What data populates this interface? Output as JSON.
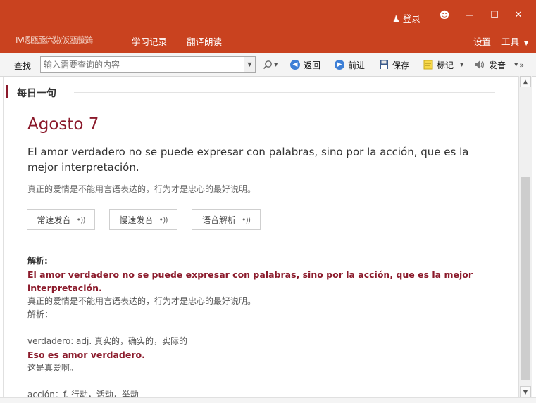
{
  "titlebar": {
    "garbled_text": "Ⅳ嗯瓯亟㈥婌仮瓯藤鷑",
    "nav": [
      "学习记录",
      "翻译朗读"
    ],
    "login_label": "登录",
    "settings_label": "设置",
    "tools_label": "工具",
    "smiley": "☻",
    "minimize": "—",
    "maximize": "☐",
    "close": "✕"
  },
  "toolbar": {
    "find_label": "查找",
    "search_placeholder": "输入需要查询的内容",
    "back_label": "返回",
    "forward_label": "前进",
    "save_label": "保存",
    "mark_label": "标记",
    "speak_label": "发音"
  },
  "daily": {
    "section_title": "每日一句",
    "date": "Agosto 7",
    "sentence": "El amor verdadero no se puede expresar con palabras, sino por la acción, que es la mejor interpretación.",
    "translation": "真正的爱情是不能用言语表达的，行为才是忠心的最好说明。",
    "buttons": [
      "常速发音",
      "慢速发音",
      "语音解析"
    ]
  },
  "analysis": {
    "heading": "解析:",
    "sentence_bold": "El amor verdadero no se puede expresar con palabras, sino por la acción, que es la mejor interpretación.",
    "translation": "真正的爱情是不能用言语表达的，行为才是忠心的最好说明。",
    "sub_label": "解析：",
    "vocab1_def": "verdadero: adj. 真实的，确实的，实际的",
    "vocab1_example": "Eso es amor verdadero.",
    "vocab1_example_trans": "这是真爱啊。",
    "vocab2_def": "acción：f. 行动，活动，举动"
  },
  "colors": {
    "titlebar": "#c9421f",
    "accent": "#8b1a2b"
  }
}
